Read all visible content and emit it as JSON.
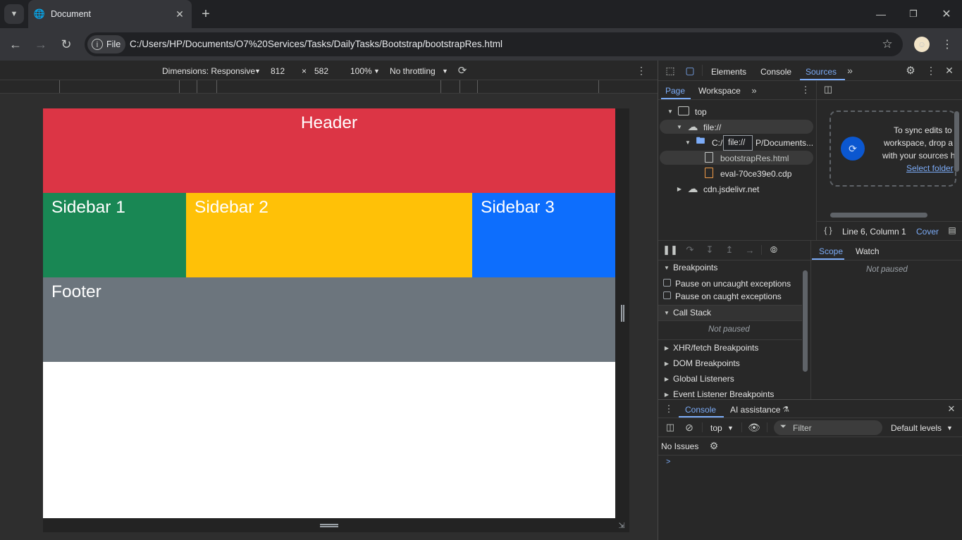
{
  "browser": {
    "tab_title": "Document",
    "chip_label": "File",
    "url": "C:/Users/HP/Documents/O7%20Services/Tasks/DailyTasks/Bootstrap/bootstrapRes.html"
  },
  "device_toolbar": {
    "dimensions_label": "Dimensions: Responsive",
    "width": "812",
    "times": "×",
    "height": "582",
    "zoom": "100%",
    "throttling": "No throttling"
  },
  "page": {
    "header": "Header",
    "sidebar1": "Sidebar 1",
    "sidebar2": "Sidebar 2",
    "sidebar3": "Sidebar 3",
    "footer": "Footer",
    "colors": {
      "header": "#dc3545",
      "sidebar1": "#198754",
      "sidebar2": "#ffc107",
      "sidebar3": "#0d6efd",
      "footer": "#6c757d"
    }
  },
  "devtools": {
    "tabs": [
      "Elements",
      "Console",
      "Sources"
    ],
    "active_tab": "Sources",
    "navigator_tabs": [
      "Page",
      "Workspace"
    ],
    "tree": {
      "top": "top",
      "file": "file://",
      "folder": "C:/",
      "folder_suffix": "P/Documents...",
      "file1": "bootstrapRes.html",
      "file2": "eval-70ce39e0.cdp",
      "cdn": "cdn.jsdelivr.net",
      "tooltip": "file://"
    },
    "workspace_hint": {
      "line1": "To sync edits to",
      "line2": "workspace, drop a",
      "line3": "with your sources h",
      "link": "Select folder"
    },
    "status": {
      "position": "Line 6, Column 1",
      "coverage": "Cover"
    },
    "scope_tabs": [
      "Scope",
      "Watch"
    ],
    "scope_not_paused": "Not paused",
    "breakpoints": {
      "title": "Breakpoints",
      "uncaught": "Pause on uncaught exceptions",
      "caught": "Pause on caught exceptions"
    },
    "call_stack": {
      "title": "Call Stack",
      "not_paused": "Not paused"
    },
    "sections": [
      "XHR/fetch Breakpoints",
      "DOM Breakpoints",
      "Global Listeners",
      "Event Listener Breakpoints"
    ],
    "drawer": {
      "tabs": [
        "Console",
        "AI assistance"
      ],
      "context": "top",
      "filter_placeholder": "Filter",
      "levels": "Default levels",
      "issues": "No Issues",
      "prompt": ">"
    }
  }
}
